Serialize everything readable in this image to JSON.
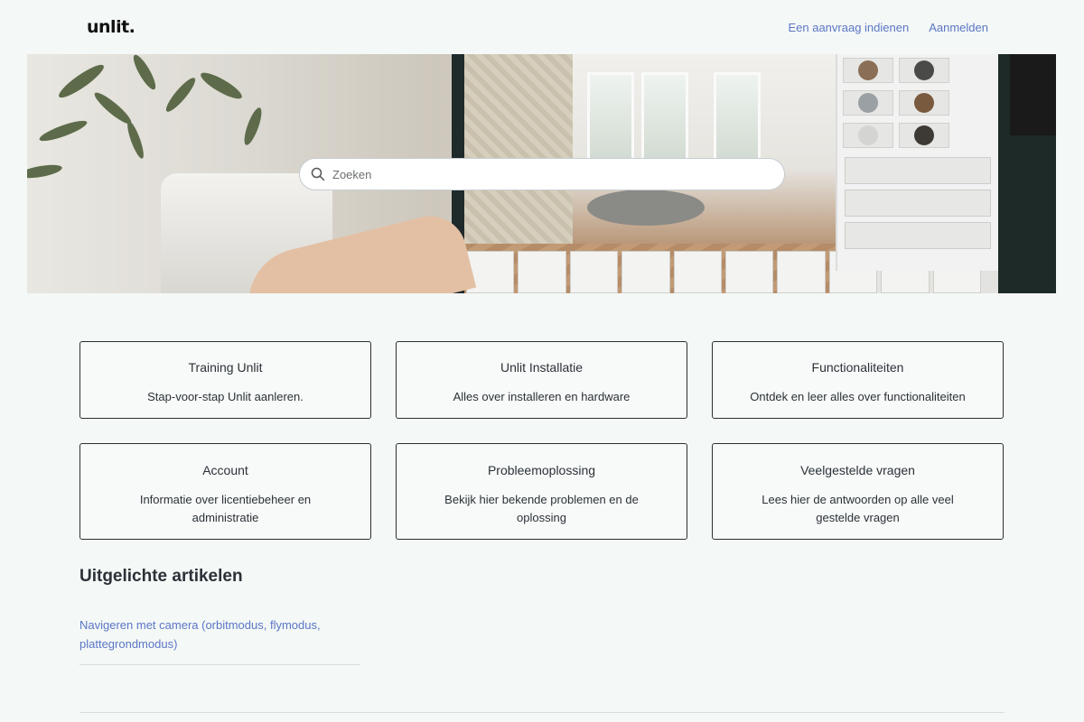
{
  "header": {
    "logo": "unlit.",
    "nav": [
      {
        "label": "Een aanvraag indienen"
      },
      {
        "label": "Aanmelden"
      }
    ]
  },
  "search": {
    "placeholder": "Zoeken"
  },
  "categories": [
    {
      "title": "Training Unlit",
      "description": "Stap-voor-stap Unlit aanleren."
    },
    {
      "title": "Unlit Installatie",
      "description": "Alles over installeren en hardware"
    },
    {
      "title": "Functionaliteiten",
      "description": "Ontdek en leer alles over functionaliteiten"
    },
    {
      "title": "Account",
      "description": "Informatie over licentiebeheer en administratie"
    },
    {
      "title": "Probleemoplossing",
      "description": "Bekijk hier bekende problemen en de oplossing"
    },
    {
      "title": "Veelgestelde vragen",
      "description": "Lees hier de antwoorden op alle veel gestelde vragen"
    }
  ],
  "featured": {
    "title": "Uitgelichte artikelen",
    "articles": [
      {
        "label": "Navigeren met camera (orbitmodus, flymodus, plattegrondmodus)"
      }
    ]
  },
  "colors": {
    "accent_link": "#5b76c6",
    "background": "#f4f8f6",
    "text": "#2b3138"
  }
}
